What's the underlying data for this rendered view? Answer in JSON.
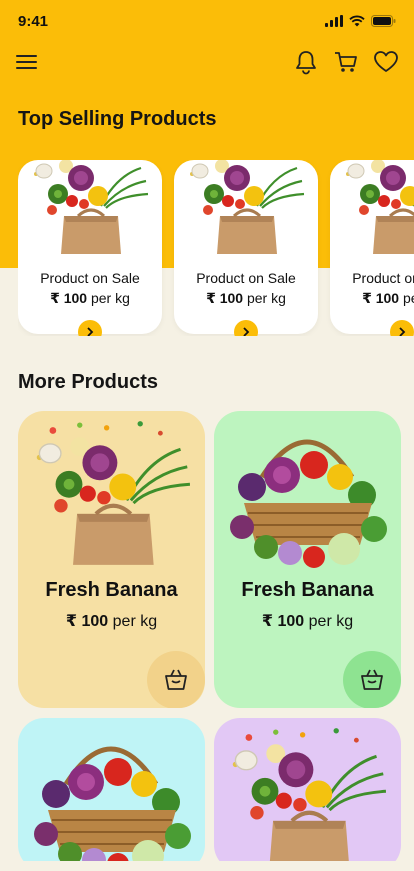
{
  "status": {
    "time": "9:41"
  },
  "top_selling": {
    "title": "Top Selling Products",
    "products": [
      {
        "name": "Product on Sale",
        "currency": "₹",
        "amount": "100",
        "unit": "per kg"
      },
      {
        "name": "Product on Sale",
        "currency": "₹",
        "amount": "100",
        "unit": "per kg"
      },
      {
        "name": "Product on Sale",
        "currency": "₹",
        "amount": "100",
        "unit": "per kg"
      }
    ]
  },
  "more_products": {
    "title": "More Products",
    "items": [
      {
        "name": "Fresh Banana",
        "currency": "₹",
        "amount": "100",
        "unit": "per kg",
        "bg": "#f6e0a4",
        "btn": "#f2d28a"
      },
      {
        "name": "Fresh Banana",
        "currency": "₹",
        "amount": "100",
        "unit": "per kg",
        "bg": "#bdf4bf",
        "btn": "#8ee391"
      },
      {
        "name": "",
        "currency": "",
        "amount": "",
        "unit": "",
        "bg": "#bff4f6",
        "btn": ""
      },
      {
        "name": "",
        "currency": "",
        "amount": "",
        "unit": "",
        "bg": "#e2c8f5",
        "btn": ""
      }
    ]
  },
  "icons": [
    "menu-icon",
    "bell-icon",
    "cart-icon",
    "heart-icon",
    "arrow-right-icon",
    "basket-icon"
  ],
  "colors": {
    "brand": "#fbbd08",
    "background": "#f5f1e4"
  }
}
